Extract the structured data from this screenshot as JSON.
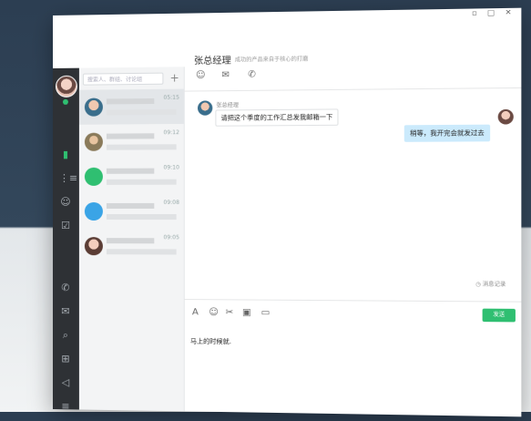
{
  "window": {
    "controls": "▫ □ ✕"
  },
  "sidebar": {
    "icons": [
      "chat-icon",
      "org-icon",
      "contacts-icon",
      "tasks-icon",
      "phone-icon",
      "mail-icon",
      "search-chat-icon",
      "apps-icon",
      "announce-icon",
      "menu-icon"
    ]
  },
  "contacts": {
    "search_placeholder": "搜索人、群组、讨论组",
    "add_label": "+",
    "items": [
      {
        "time": "05:15"
      },
      {
        "time": "09:12"
      },
      {
        "time": "09:10"
      },
      {
        "time": "09:08"
      },
      {
        "time": "09:05"
      }
    ]
  },
  "chat": {
    "title": "张总经理",
    "subtitle": "成功的产品来自于核心的打磨",
    "messages": [
      {
        "sender": "张总经理",
        "text": "请把这个季度的工作汇总发我邮箱一下",
        "side": "left"
      },
      {
        "text": "稍等，我开完会就发过去",
        "side": "right"
      }
    ],
    "history_label": "消息记录"
  },
  "composer": {
    "input_text": "马上的时候就.",
    "send_label": "发送"
  },
  "colors": {
    "accent": "#2fbf71",
    "sidebar_bg": "#2e3135",
    "bubble_right": "#cbeafc"
  }
}
